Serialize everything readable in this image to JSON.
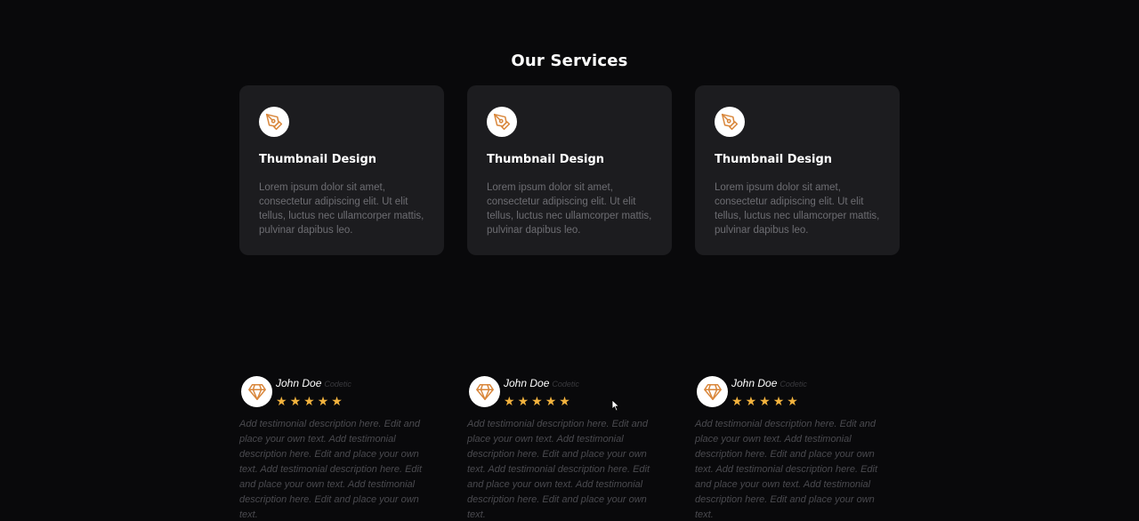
{
  "services": {
    "title": "Our Services",
    "cards": [
      {
        "icon": "pen-nib-icon",
        "title": "Thumbnail Design",
        "description": "Lorem ipsum dolor sit amet, consectetur adipiscing elit. Ut elit tellus, luctus nec ullamcorper mattis, pulvinar dapibus leo."
      },
      {
        "icon": "pen-nib-icon",
        "title": "Thumbnail Design",
        "description": "Lorem ipsum dolor sit amet, consectetur adipiscing elit. Ut elit tellus, luctus nec ullamcorper mattis, pulvinar dapibus leo."
      },
      {
        "icon": "pen-nib-icon",
        "title": "Thumbnail Design",
        "description": "Lorem ipsum dolor sit amet, consectetur adipiscing elit. Ut elit tellus, luctus nec ullamcorper mattis, pulvinar dapibus leo."
      }
    ]
  },
  "testimonials": [
    {
      "avatar_icon": "diamond-icon",
      "name": "John Doe",
      "company": "Codetic",
      "rating": 5,
      "stars": "★★★★★",
      "description": "Add testimonial description here. Edit and place your own text. Add testimonial description here. Edit and place your own text. Add testimonial description here. Edit and place your own text. Add testimonial description here. Edit and place your own text."
    },
    {
      "avatar_icon": "diamond-icon",
      "name": "John Doe",
      "company": "Codetic",
      "rating": 5,
      "stars": "★★★★★",
      "description": "Add testimonial description here. Edit and place your own text. Add testimonial description here. Edit and place your own text. Add testimonial description here. Edit and place your own text. Add testimonial description here. Edit and place your own text."
    },
    {
      "avatar_icon": "diamond-icon",
      "name": "John Doe",
      "company": "Codetic",
      "rating": 5,
      "stars": "★★★★★",
      "description": "Add testimonial description here. Edit and place your own text. Add testimonial description here. Edit and place your own text. Add testimonial description here. Edit and place your own text. Add testimonial description here. Edit and place your own text."
    }
  ],
  "colors": {
    "background": "#09090b",
    "card_background": "#1c1c1f",
    "accent": "#d9863a",
    "star": "#f3b33e"
  }
}
